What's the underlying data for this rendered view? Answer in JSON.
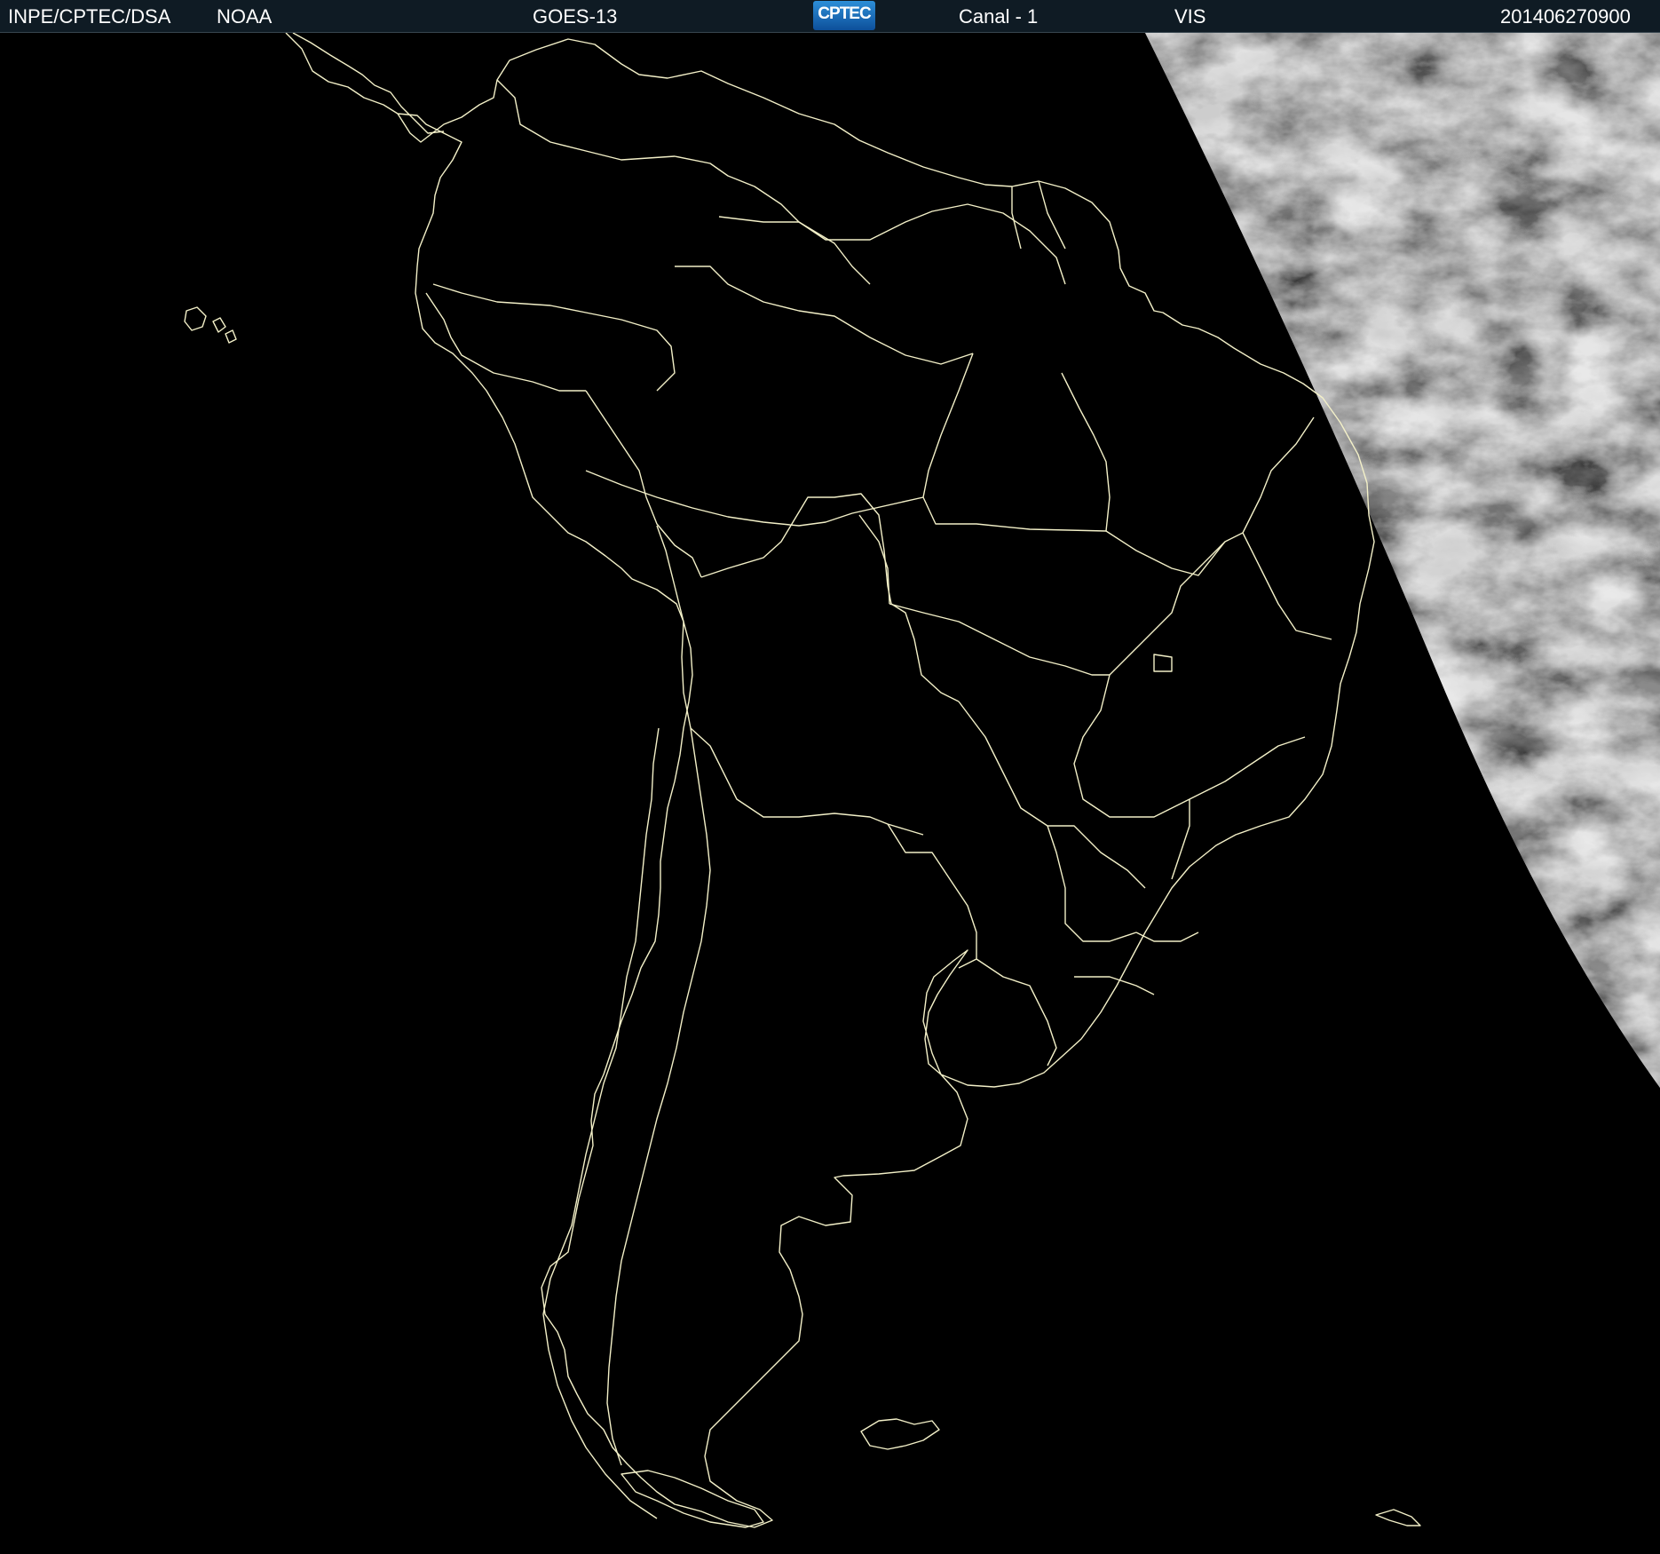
{
  "header": {
    "agency": "INPE/CPTEC/DSA",
    "provider": "NOAA",
    "satellite": "GOES-13",
    "logo_text": "CPTEC",
    "channel": "Canal - 1",
    "band": "VIS",
    "timestamp": "201406270900"
  },
  "map": {
    "region": "South America",
    "features": [
      "coastlines",
      "country-borders",
      "brazil-state-borders",
      "cloud-imagery"
    ],
    "colors": {
      "background": "#000000",
      "border_lines": "#f3f0c8",
      "header_bg": "#0f1b24",
      "cloud_field": "#7a7a7a"
    }
  }
}
